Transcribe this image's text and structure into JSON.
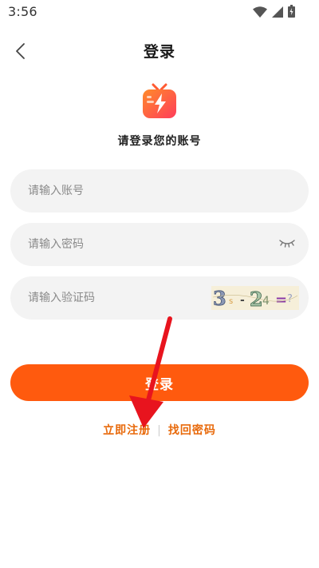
{
  "status_bar": {
    "time": "3:56",
    "icons": [
      "wifi-icon",
      "signal-icon",
      "battery-icon"
    ]
  },
  "header": {
    "title": "登录",
    "back_icon": "chevron-left-icon"
  },
  "logo": {
    "icon": "tv-lightning-logo",
    "colors": {
      "gradient_start": "#ff7a2a",
      "gradient_end": "#ff3d5a"
    }
  },
  "subtitle": "请登录您的账号",
  "form": {
    "account": {
      "placeholder": "请输入账号",
      "value": ""
    },
    "password": {
      "placeholder": "请输入密码",
      "value": "",
      "toggle_icon": "eye-closed-icon"
    },
    "captcha": {
      "placeholder": "请输入验证码",
      "value": "",
      "image_text": "3 - 2 ="
    }
  },
  "login_button": {
    "label": "登录"
  },
  "links": {
    "register": "立即注册",
    "separator": "|",
    "forgot_password": "找回密码"
  },
  "colors": {
    "accent": "#ff5a0e",
    "link": "#e8690a",
    "field_bg": "#f3f3f3",
    "annotation_arrow": "#e8141e"
  }
}
